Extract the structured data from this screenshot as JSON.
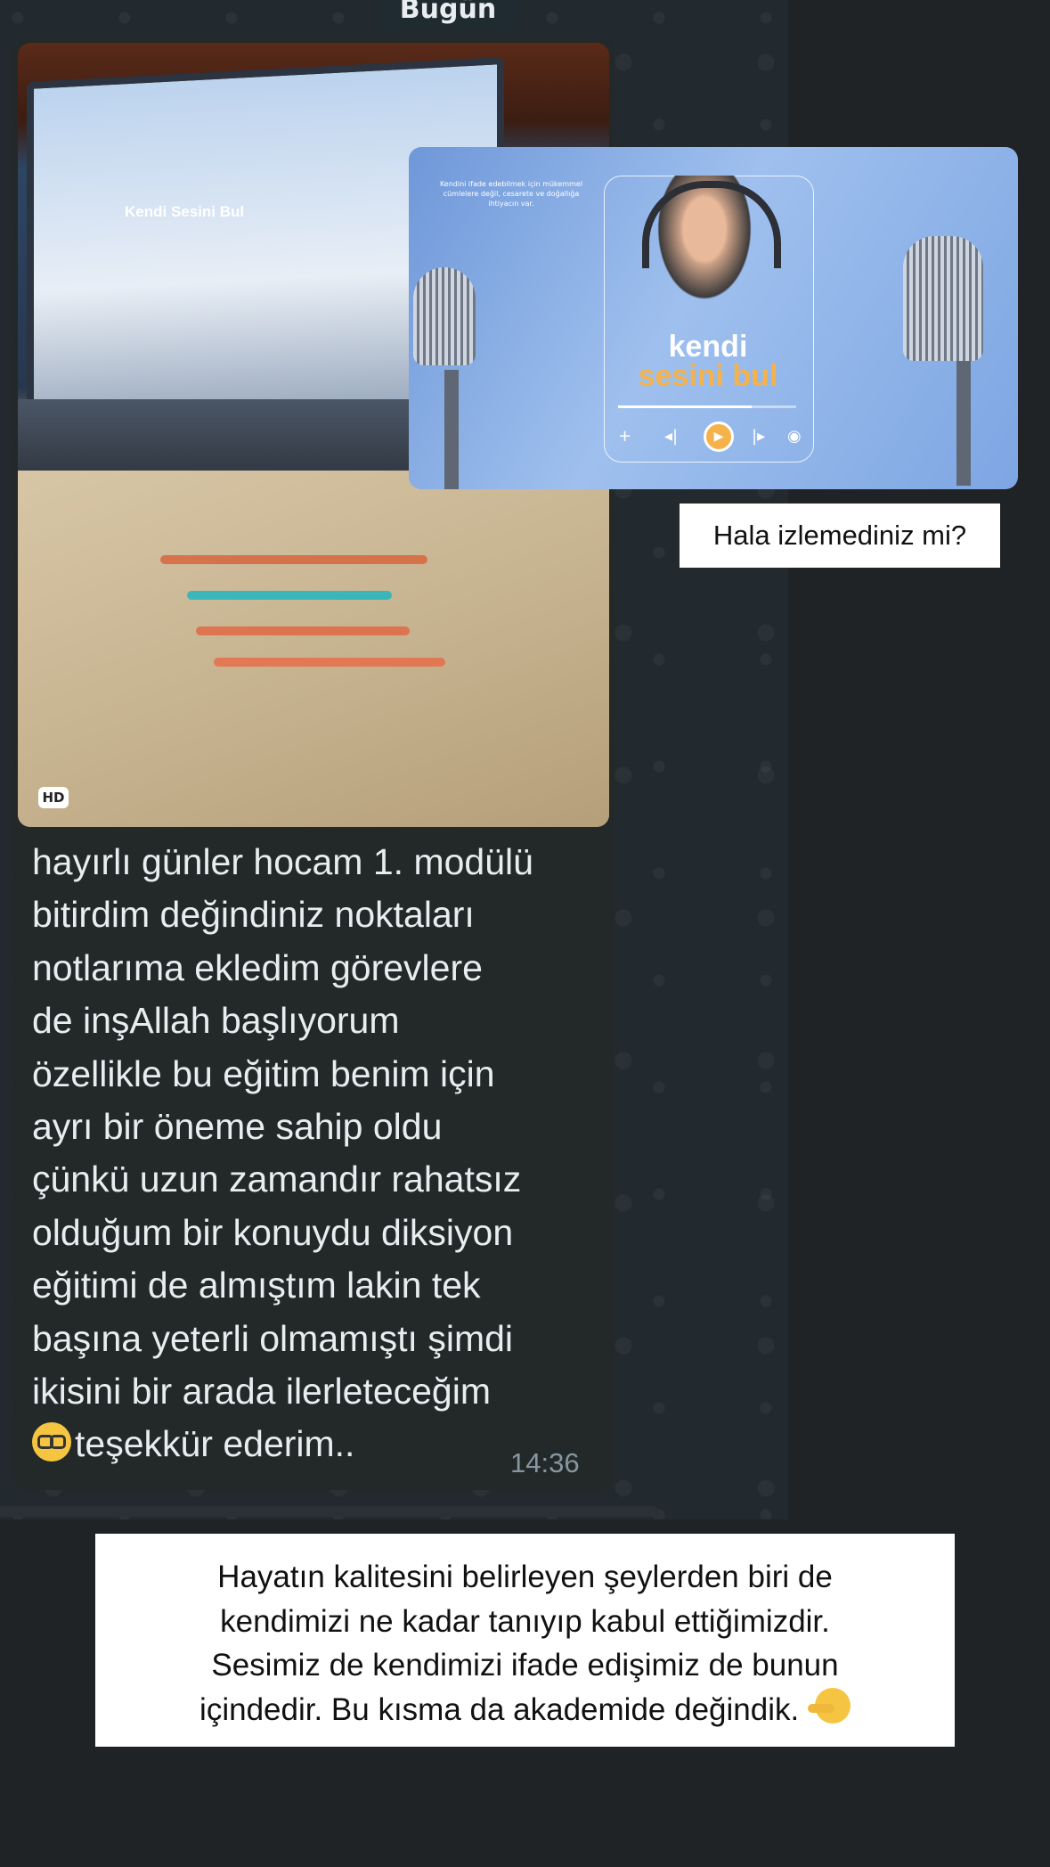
{
  "chat": {
    "date_divider": "Bugün",
    "message": {
      "text": "hayırlı günler hocam 1. modülü\nbitirdim değindiniz noktaları\nnotlarıma ekledim görevlere\nde inşAllah başlıyorum\nözellikle bu eğitim benim için\nayrı bir öneme sahip oldu\nçünkü uzun zamandır rahatsız\nolduğum bir konuydu diksiyon\neğitimi de almıştım lakin tek\nbaşına yeterli olmamıştı şimdi\nikisini bir arada ilerleteceğim",
      "last_line": "teşekkür ederim..",
      "emoji": "nerd-face-emoji",
      "time": "14:36",
      "photo_badge": "HD",
      "photo_screen_title": "Kendi Sesini Bul"
    }
  },
  "promo": {
    "small_text": "Kendini ifade edebilmek için mükemmel cümlelere değil, cesarete ve doğallığa ihtiyacın var.",
    "title_line1": "kendi",
    "title_line2": "sesini bul",
    "progress": 0.75,
    "caption": "Hala izlemediniz mi?"
  },
  "quote": {
    "text": "Hayatın kalitesini belirleyen şeylerden biri de\nkendimizi ne kadar tanıyıp kabul ettiğimizdir.\nSesimiz de kendimizi ifade edişimiz de bunun\niçindedir. Bu kısma da akademide değindik.",
    "emoji": "pointing-left-emoji"
  },
  "colors": {
    "accent_orange": "#f6b24a",
    "promo_blue": "#7ea6e3",
    "chat_bg": "#232a2f"
  }
}
